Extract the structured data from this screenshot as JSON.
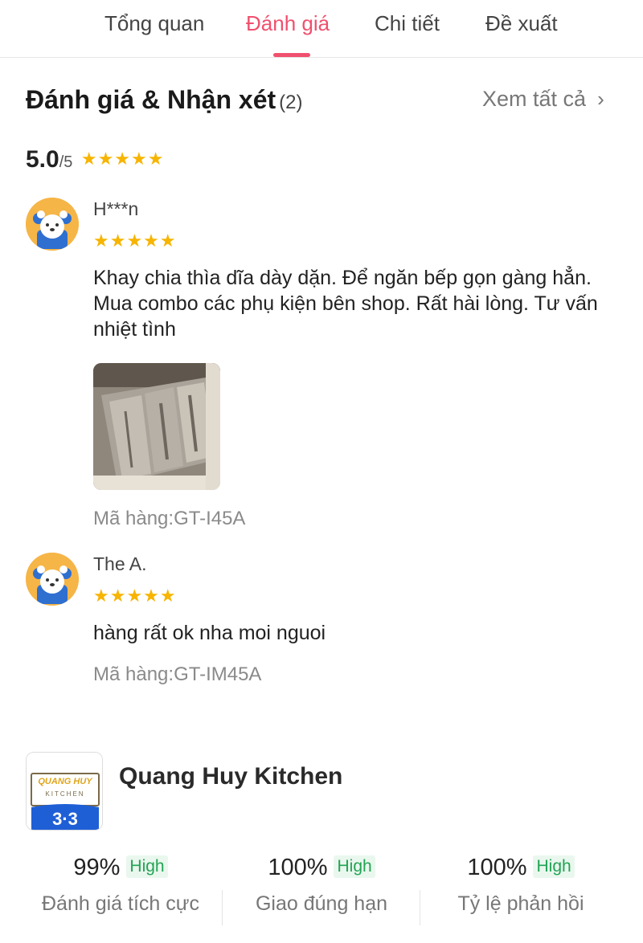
{
  "tabs": [
    {
      "label": "Tổng quan"
    },
    {
      "label": "Đánh giá"
    },
    {
      "label": "Chi tiết"
    },
    {
      "label": "Đề xuất"
    }
  ],
  "active_tab": "Đánh giá",
  "reviews_section": {
    "title": "Đánh giá & Nhận xét",
    "count": "(2)",
    "see_all": "Xem tất cả",
    "see_all_icon": "chevron-right-icon",
    "overall_score": "5.0",
    "overall_outof": "/5",
    "overall_stars": 5
  },
  "reviews": [
    {
      "reviewer": "H***n",
      "stars": 5,
      "text": "Khay chia thìa dĩa dày dặn. Để ngăn bếp gọn gàng hẳn. Mua combo các phụ kiện bên shop. Rất hài lòng. Tư vấn nhiệt tình",
      "has_photo": true,
      "sku": "Mã hàng:GT-I45A"
    },
    {
      "reviewer": "The A.",
      "stars": 5,
      "text": "hàng rất ok nha moi nguoi",
      "has_photo": false,
      "sku": "Mã hàng:GT-IM45A"
    }
  ],
  "shop": {
    "name": "Quang Huy Kitchen",
    "logo_text_top": "QUANG HUY",
    "logo_text_bottom": "KITCHEN",
    "logo_badge": "3·3",
    "stats": [
      {
        "value": "99%",
        "badge": "High",
        "label": "Đánh giá tích cực"
      },
      {
        "value": "100%",
        "badge": "High",
        "label": "Giao đúng hạn"
      },
      {
        "value": "100%",
        "badge": "High",
        "label": "Tỷ lệ phản hồi"
      }
    ]
  },
  "colors": {
    "accent": "#f0506e",
    "star": "#f7b400",
    "badge_green": "#22a454",
    "avatar_bg": "#f6b547",
    "logo_blue": "#1f5fd6"
  }
}
